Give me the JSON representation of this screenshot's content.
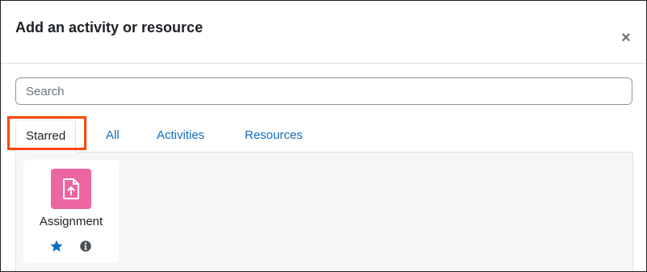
{
  "dialog": {
    "title": "Add an activity or resource",
    "close_icon": "close-icon",
    "close_symbol": "×"
  },
  "search": {
    "placeholder": "Search",
    "value": ""
  },
  "tabs": [
    {
      "label": "Starred",
      "active": true
    },
    {
      "label": "All",
      "active": false
    },
    {
      "label": "Activities",
      "active": false
    },
    {
      "label": "Resources",
      "active": false
    }
  ],
  "items": [
    {
      "label": "Assignment",
      "icon": "assignment-upload-icon",
      "icon_bg": "#eb66a2",
      "starred": true,
      "star_icon": "star-icon",
      "info_icon": "info-icon"
    }
  ],
  "colors": {
    "link": "#0f6cbf",
    "highlight": "#ff4500",
    "star": "#0f6cbf"
  }
}
